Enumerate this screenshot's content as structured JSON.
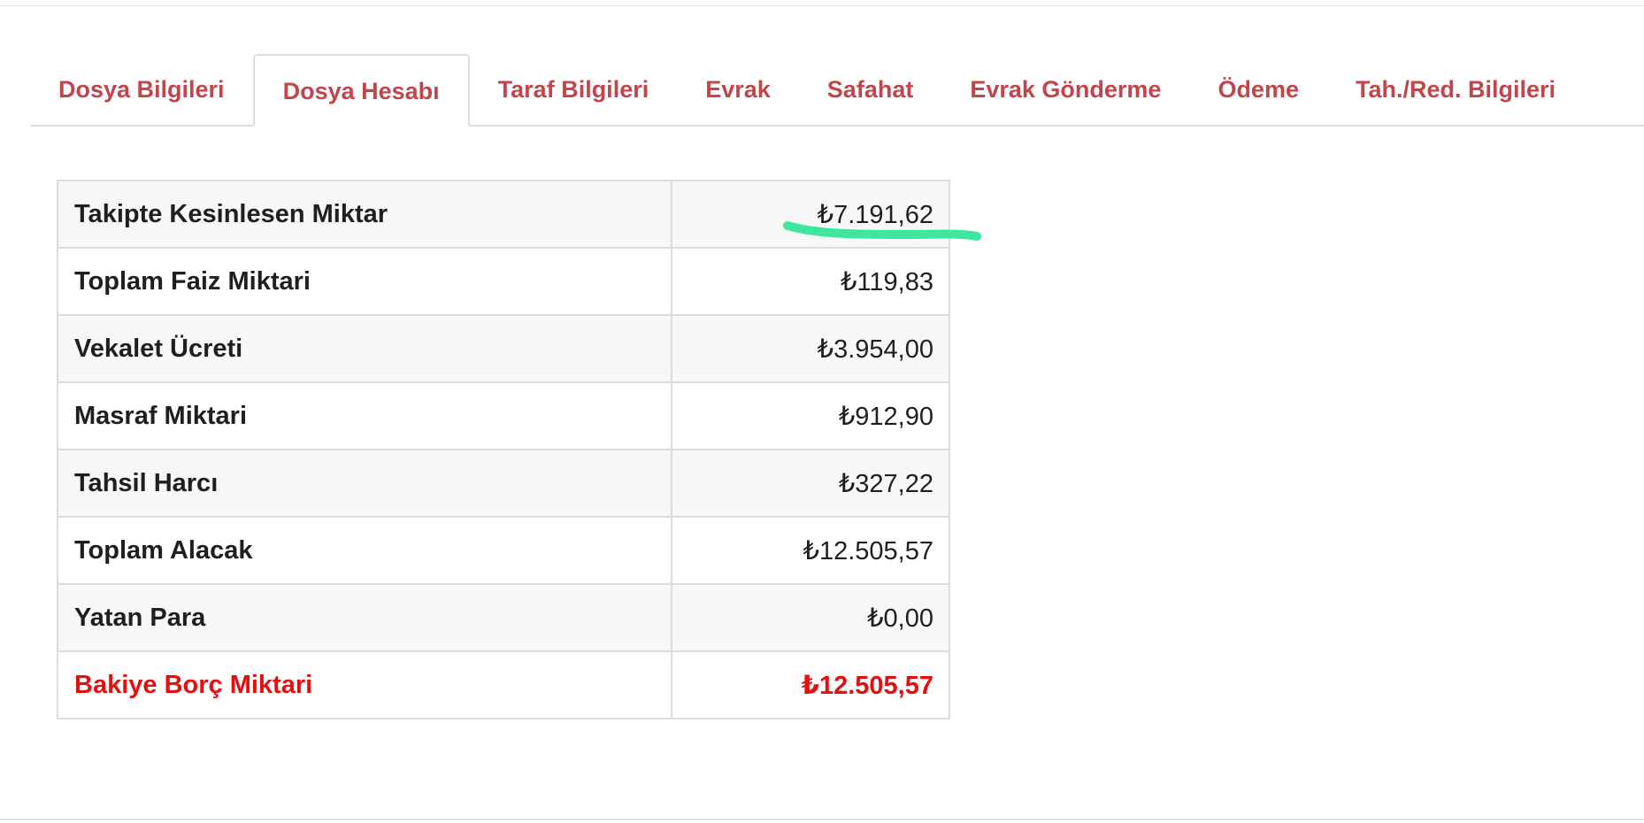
{
  "tabs": [
    {
      "label": "Dosya Bilgileri",
      "active": false
    },
    {
      "label": "Dosya Hesabı",
      "active": true
    },
    {
      "label": "Taraf Bilgileri",
      "active": false
    },
    {
      "label": "Evrak",
      "active": false
    },
    {
      "label": "Safahat",
      "active": false
    },
    {
      "label": "Evrak Gönderme",
      "active": false
    },
    {
      "label": "Ödeme",
      "active": false
    },
    {
      "label": "Tah./Red. Bilgileri",
      "active": false
    }
  ],
  "account": {
    "rows": [
      {
        "label": "Takipte Kesinlesen Miktar",
        "value": "₺7.191,62"
      },
      {
        "label": "Toplam Faiz Miktari",
        "value": "₺119,83"
      },
      {
        "label": "Vekalet Ücreti",
        "value": "₺3.954,00"
      },
      {
        "label": "Masraf Miktari",
        "value": "₺912,90"
      },
      {
        "label": "Tahsil Harcı",
        "value": "₺327,22"
      },
      {
        "label": "Toplam Alacak",
        "value": "₺12.505,57"
      },
      {
        "label": "Yatan Para",
        "value": "₺0,00"
      },
      {
        "label": "Bakiye Borç Miktari",
        "value": "₺12.505,57"
      }
    ]
  },
  "colors": {
    "tab_text": "#c0464b",
    "total_text": "#e60f0f",
    "highlight_stroke": "#3ee6a0",
    "border": "#dcdcdc"
  }
}
